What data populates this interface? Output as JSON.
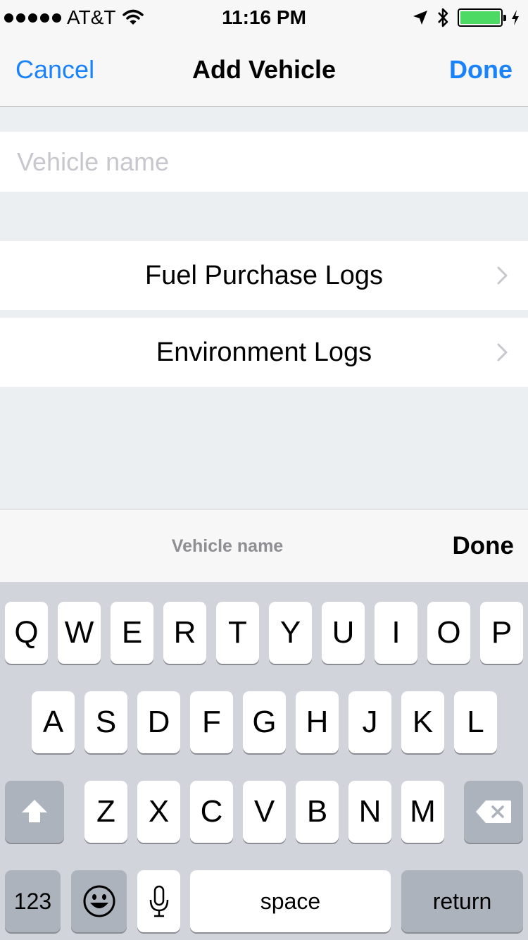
{
  "status_bar": {
    "carrier": "AT&T",
    "time": "11:16 PM",
    "battery_color": "#4cd964"
  },
  "nav": {
    "cancel_label": "Cancel",
    "title": "Add Vehicle",
    "done_label": "Done",
    "accent_color": "#1a82fb"
  },
  "form": {
    "vehicle_name_placeholder": "Vehicle name",
    "vehicle_name_value": ""
  },
  "cells": [
    {
      "label": "Fuel Purchase Logs",
      "icon": "chevron-right-icon"
    },
    {
      "label": "Environment Logs",
      "icon": "chevron-right-icon"
    }
  ],
  "accessory": {
    "title": "Vehicle name",
    "done_label": "Done"
  },
  "keyboard": {
    "row1": [
      "Q",
      "W",
      "E",
      "R",
      "T",
      "Y",
      "U",
      "I",
      "O",
      "P"
    ],
    "row2": [
      "A",
      "S",
      "D",
      "F",
      "G",
      "H",
      "J",
      "K",
      "L"
    ],
    "row3": [
      "Z",
      "X",
      "C",
      "V",
      "B",
      "N",
      "M"
    ],
    "numbers_label": "123",
    "space_label": "space",
    "return_label": "return",
    "shift_icon": "shift-icon",
    "delete_icon": "delete-icon",
    "emoji_icon": "emoji-icon",
    "mic_icon": "microphone-icon"
  }
}
